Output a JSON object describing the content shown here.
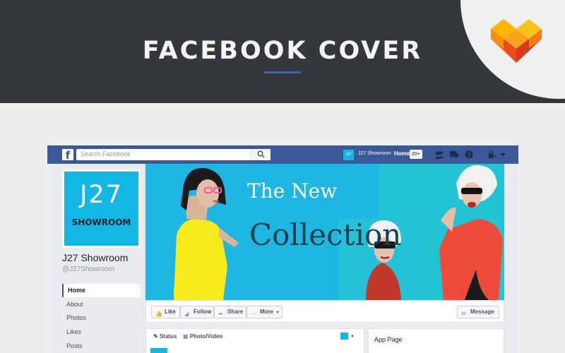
{
  "banner": {
    "title": "FACEBOOK COVER",
    "accent": "#3f64a8",
    "logo_icon": "heart-cube-logo"
  },
  "facebook": {
    "logo_letter": "f",
    "search_placeholder": "Search Facebook",
    "nav": {
      "avatar_text": "J27",
      "profile_name": "J27 Showroom",
      "home_label": "Home",
      "notification_count": "20+",
      "icons": [
        "friends-icon",
        "messages-icon",
        "globe-icon",
        "lock-icon",
        "caret-down-icon"
      ]
    },
    "page": {
      "logo_line1": "J27",
      "logo_line2": "SHOWROOM",
      "name": "J27 Showroom",
      "handle": "@J27Showroom",
      "brand_color": "#12b7e4"
    },
    "left_nav": [
      {
        "label": "Home",
        "active": true
      },
      {
        "label": "About"
      },
      {
        "label": "Photos"
      },
      {
        "label": "Likes"
      },
      {
        "label": "Posts"
      }
    ],
    "cover": {
      "line1": "The New",
      "line2": "Collection"
    },
    "actions": {
      "like": "Like",
      "follow": "Follow",
      "share": "Share",
      "more": "More",
      "message": "Message"
    },
    "composer": {
      "status": "Status",
      "photo_video": "Photo/Video"
    },
    "app_page": "App Page"
  }
}
